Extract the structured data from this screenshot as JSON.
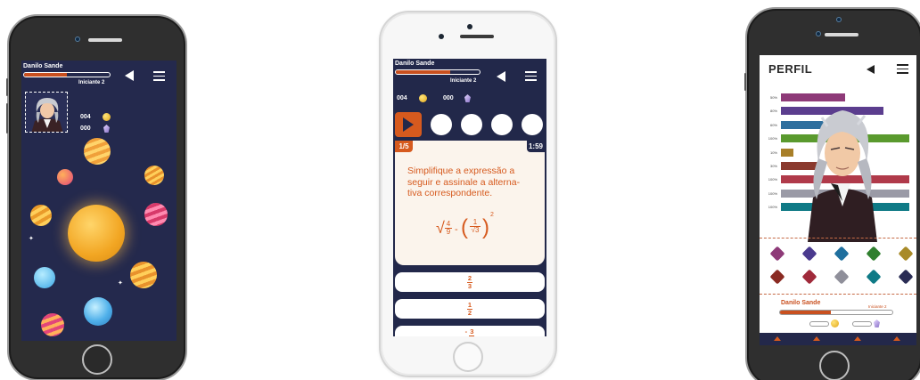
{
  "phone1": {
    "header": {
      "name": "Danilo Sande",
      "level": "Iniciante 2",
      "progress": 0.5
    },
    "counters": {
      "coins": "004",
      "gems": "000"
    }
  },
  "phone2": {
    "header": {
      "name": "Danilo Sande",
      "level": "Iniciante 2",
      "progress": 0.65
    },
    "counters": {
      "coins": "004",
      "gems": "000"
    },
    "question": {
      "number": "1/5",
      "timer": "1:59",
      "text": "Simplifique a expressão a seguir e assinale a alterna-tiva correspondente.",
      "formula": {
        "frac_num": "4",
        "frac_den": "9",
        "inner_num": "1",
        "inner_den": "3",
        "minus": "-",
        "exponent": "2"
      }
    },
    "options": [
      {
        "num": "2",
        "den": "3"
      },
      {
        "num": "1",
        "den": "2"
      },
      {
        "sign": "-",
        "num": "3",
        "den": ""
      }
    ]
  },
  "phone3": {
    "title": "PERFIL",
    "stats": [
      {
        "label": "50%",
        "value": 0.5,
        "color": "#8e3a78"
      },
      {
        "label": "80%",
        "value": 0.8,
        "color": "#5b3d8e"
      },
      {
        "label": "60%",
        "value": 0.6,
        "color": "#2f6f9e"
      },
      {
        "label": "100%",
        "value": 1.0,
        "color": "#5a9a2e"
      },
      {
        "label": "10%",
        "value": 0.1,
        "color": "#a87f28"
      },
      {
        "label": "30%",
        "value": 0.3,
        "color": "#8a3a2e"
      },
      {
        "label": "100%",
        "value": 1.0,
        "color": "#b03a4a"
      },
      {
        "label": "100%",
        "value": 1.0,
        "color": "#9a9aa6"
      },
      {
        "label": "100%",
        "value": 1.0,
        "color": "#0f7a86"
      }
    ],
    "badges_row1": [
      "#8e3a78",
      "#4a3a8e",
      "#1f6f9e",
      "#2f7f2e",
      "#a88a28"
    ],
    "badges_row2": [
      "#8a2a22",
      "#a02a3a",
      "#8f8f9a",
      "#0f7a86",
      "#2a2d55"
    ],
    "profile": {
      "name": "Danilo Sande",
      "level": "Iniciante 2",
      "progress": 0.45
    }
  }
}
